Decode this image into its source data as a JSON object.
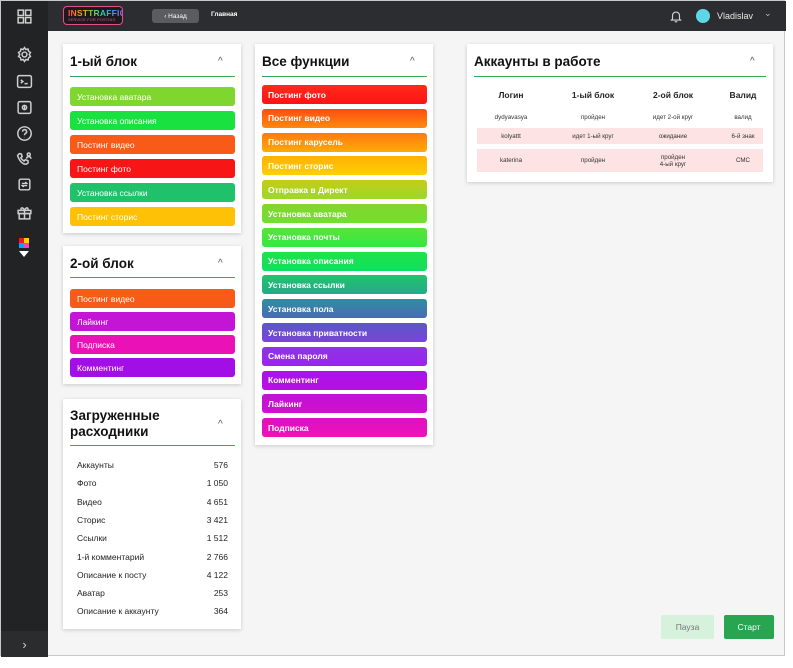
{
  "logo": {
    "line1": "INSTTRAFFIC",
    "line2": "SERVICE FOR POSTING"
  },
  "topbar": {
    "back_label": "‹ Назад",
    "breadcrumb": "Главная",
    "user_name": "Vladislav"
  },
  "block1": {
    "title": "1-ый блок",
    "buttons": [
      {
        "label": "Установка аватара",
        "color": "#7ed62e"
      },
      {
        "label": "Установка описания",
        "color": "#19e13f"
      },
      {
        "label": "Постинг видео",
        "color": "#f85a17"
      },
      {
        "label": "Постинг фото",
        "color": "#f81515"
      },
      {
        "label": "Установка ссылки",
        "color": "#1fc26b"
      },
      {
        "label": "Постинг сторис",
        "color": "#ffc105"
      }
    ]
  },
  "block2": {
    "title": "2-ой блок",
    "buttons": [
      {
        "label": "Постинг видео",
        "color": "#f85a17"
      },
      {
        "label": "Лайкинг",
        "color": "#c414d6"
      },
      {
        "label": "Подписка",
        "color": "#ea12b6"
      },
      {
        "label": "Комментинг",
        "color": "#a20ee6"
      }
    ]
  },
  "resources": {
    "title_line1": "Загруженные",
    "title_line2": "расходники",
    "rows": [
      {
        "label": "Аккаунты",
        "value": "576"
      },
      {
        "label": "Фото",
        "value": "1 050"
      },
      {
        "label": "Видео",
        "value": "4 651"
      },
      {
        "label": "Сторис",
        "value": "3 421"
      },
      {
        "label": "Ссылки",
        "value": "1 512"
      },
      {
        "label": "1-й комментарий",
        "value": "2 766"
      },
      {
        "label": "Описание к посту",
        "value": "4 122"
      },
      {
        "label": "Аватар",
        "value": "253"
      },
      {
        "label": "Описание к аккаунту",
        "value": "364"
      }
    ]
  },
  "functions": {
    "title": "Все функции",
    "buttons": [
      {
        "label": "Постинг фото",
        "from": "#ff2a1a",
        "to": "#ff1414"
      },
      {
        "label": "Постинг видео",
        "from": "#ff4d12",
        "to": "#ff8a0f"
      },
      {
        "label": "Постинг карусель",
        "from": "#ff7a10",
        "to": "#ffaa08"
      },
      {
        "label": "Постинг сторис",
        "from": "#ffb007",
        "to": "#ffd000"
      },
      {
        "label": "Отправка в Директ",
        "from": "#c6cc18",
        "to": "#9ad82a"
      },
      {
        "label": "Установка аватара",
        "from": "#85d42c",
        "to": "#6fe030"
      },
      {
        "label": "Установка почты",
        "from": "#58e33a",
        "to": "#34e840"
      },
      {
        "label": "Установка описания",
        "from": "#1fe348",
        "to": "#10e060"
      },
      {
        "label": "Установка ссылки",
        "from": "#1fc56c",
        "to": "#27a88a"
      },
      {
        "label": "Установка пола",
        "from": "#2d8f9e",
        "to": "#4a6ab8"
      },
      {
        "label": "Установка приватности",
        "from": "#5a58c8",
        "to": "#7a45d6"
      },
      {
        "label": "Смена пароля",
        "from": "#8a36e4",
        "to": "#9d22ee"
      },
      {
        "label": "Комментинг",
        "from": "#a914ea",
        "to": "#b80fe0"
      },
      {
        "label": "Лайкинг",
        "from": "#c012d8",
        "to": "#d010cc"
      },
      {
        "label": "Подписка",
        "from": "#dc10c4",
        "to": "#ee12b6"
      }
    ]
  },
  "accounts": {
    "title": "Аккаунты в работе",
    "headers": [
      "Логин",
      "1-ый блок",
      "2-ой блок",
      "Валид"
    ],
    "rows": [
      {
        "login": "dydyavasya",
        "b1": "пройден",
        "b2": "идет 2-ой круг",
        "b2_line2": "",
        "valid": "валид",
        "bg": "#ffffff"
      },
      {
        "login": "kolyattt",
        "b1": "идет 1-ый круг",
        "b2": "ожидание",
        "b2_line2": "",
        "valid": "6-й знак",
        "bg": "#fde3e3"
      },
      {
        "login": "katerina",
        "b1": "пройден",
        "b2": "пройден",
        "b2_line2": "4-ый круг",
        "valid": "СМС",
        "bg": "#fde3e3"
      }
    ]
  },
  "actions": {
    "pause_label": "Пауза",
    "start_label": "Старт"
  },
  "icons": {
    "sidebar": [
      "grid-icon",
      "settings-icon",
      "terminal-icon",
      "wallet-icon",
      "help-icon",
      "phone-user-icon",
      "sync-icon",
      "gift-icon",
      "color-palette-icon"
    ],
    "sidebar_expand": "chevron-right-icon",
    "notification": "bell-icon",
    "user_menu": "chevron-down-icon"
  }
}
